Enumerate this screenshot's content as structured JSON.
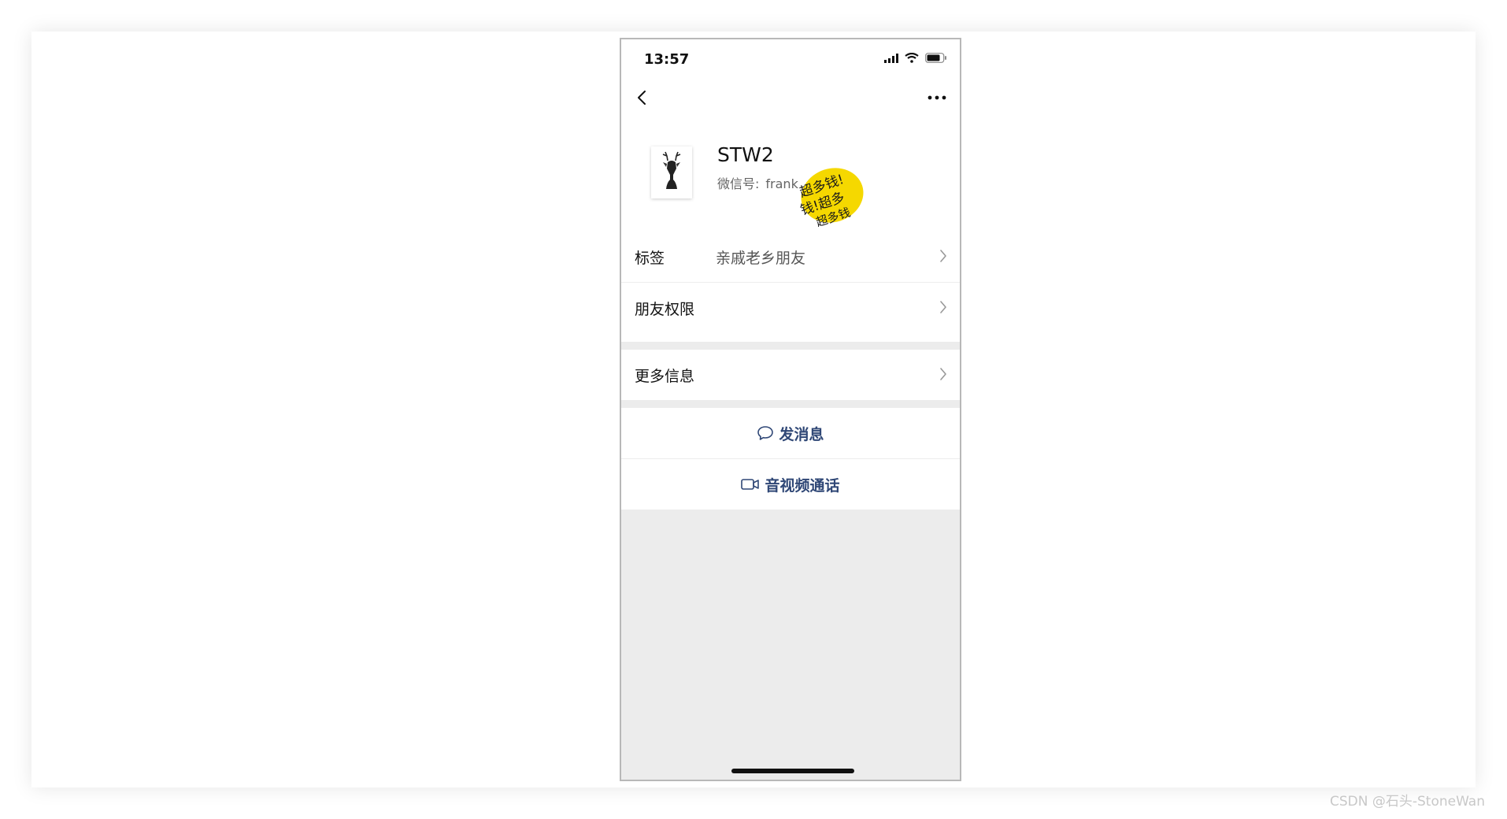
{
  "status_bar": {
    "time": "13:57"
  },
  "profile": {
    "name": "STW2",
    "wechat_id_label": "微信号:",
    "wechat_id_value": "frank",
    "sticker_text": "超多钱!超多钱!超多钱!"
  },
  "rows": [
    {
      "label": "标签",
      "value": "亲戚老乡朋友"
    },
    {
      "label": "朋友权限",
      "value": ""
    },
    {
      "label": "更多信息",
      "value": ""
    }
  ],
  "actions": {
    "message": "发消息",
    "call": "音视频通话"
  },
  "watermark": "CSDN @石头-StoneWan",
  "colors": {
    "action_text": "#2f4776",
    "section_gap": "#ececec",
    "sticker_yellow": "#f5d800"
  }
}
